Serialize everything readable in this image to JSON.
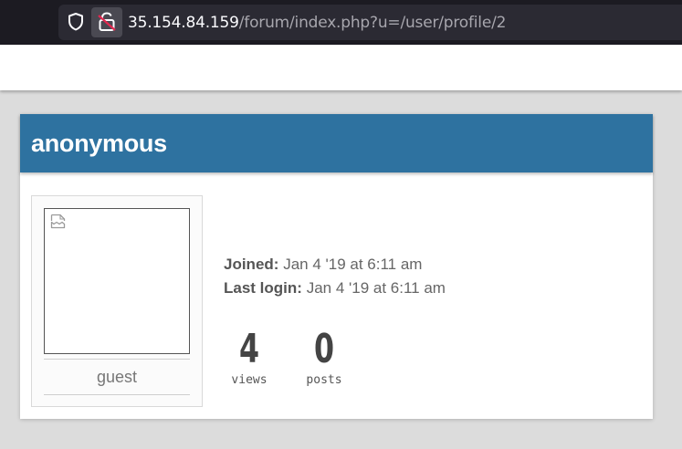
{
  "browser": {
    "url_host": "35.154.84.159",
    "url_path": "/forum/index.php?u=/user/profile/2"
  },
  "profile": {
    "username": "anonymous",
    "role": "guest",
    "joined_label": "Joined:",
    "joined_value": "Jan 4 '19 at 6:11 am",
    "last_login_label": "Last login:",
    "last_login_value": "Jan 4 '19 at 6:11 am",
    "stats": [
      {
        "value": "4",
        "label": "views"
      },
      {
        "value": "0",
        "label": "posts"
      }
    ]
  },
  "icons": {
    "tracking_protection": "shield-icon",
    "insecure_connection": "broken-lock-icon",
    "avatar_missing": "broken-image-icon"
  }
}
